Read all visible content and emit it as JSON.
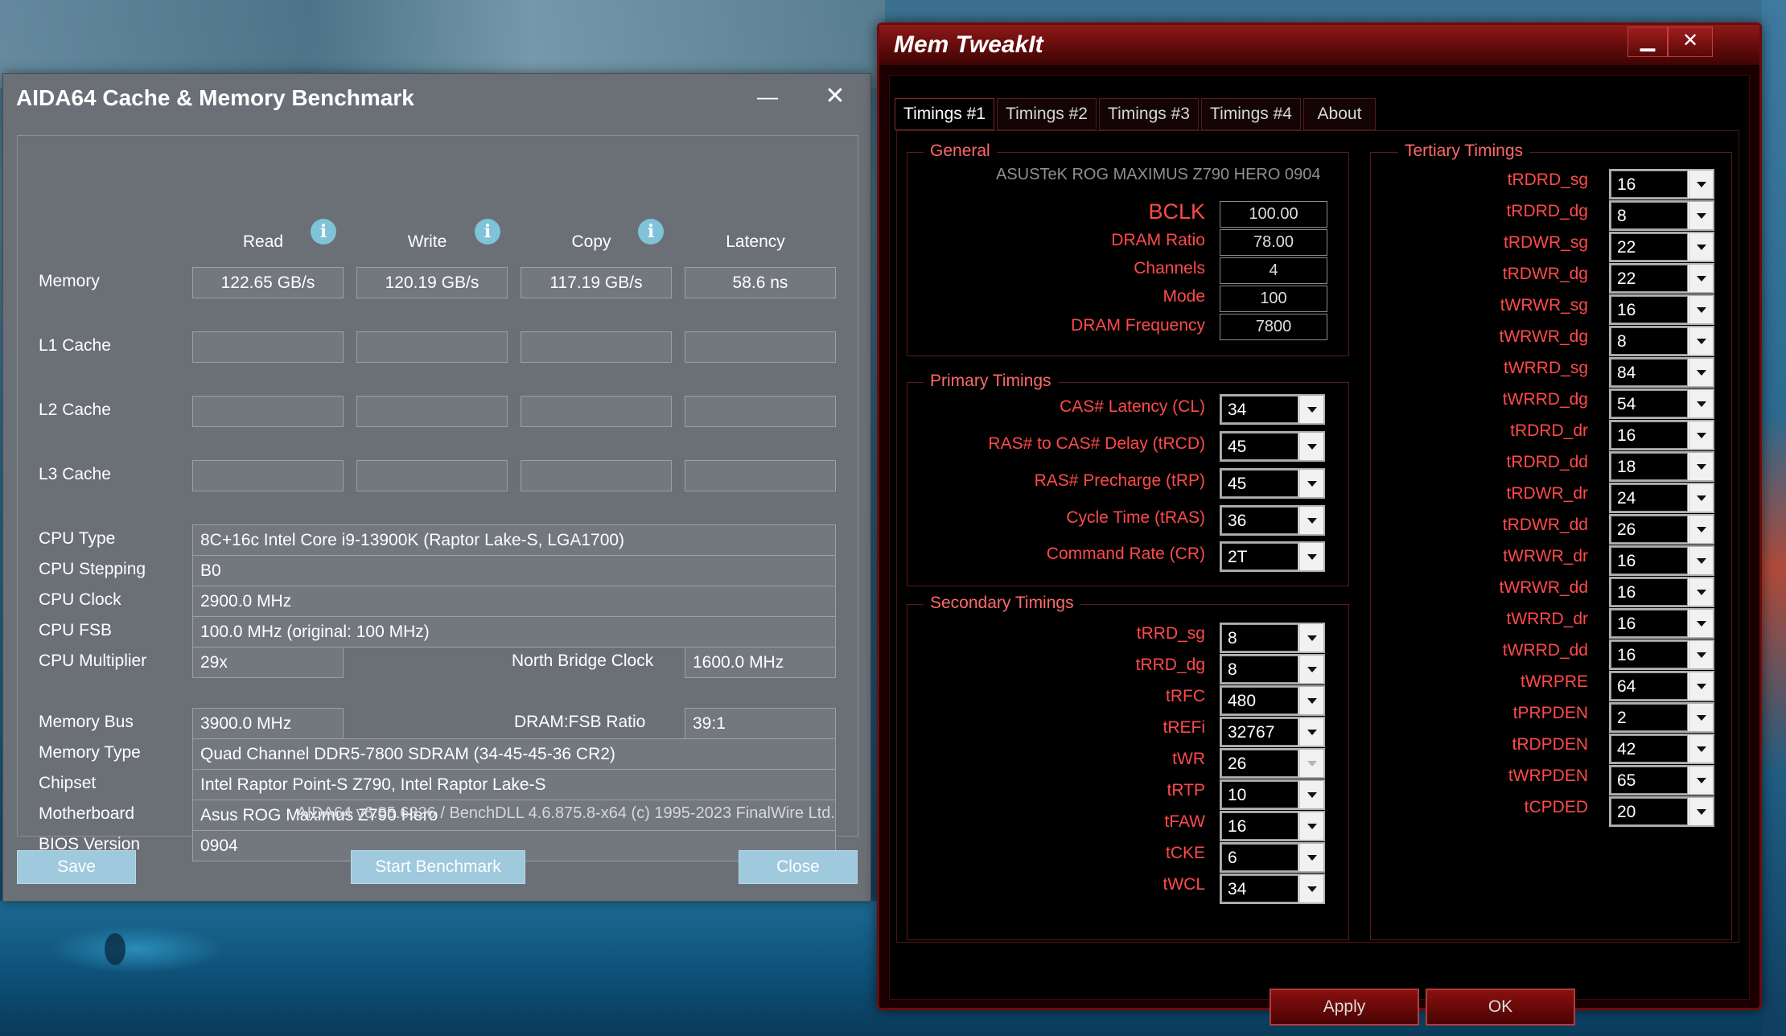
{
  "aida": {
    "title": "AIDA64 Cache & Memory Benchmark",
    "minimize": "—",
    "close_x": "✕",
    "headers": {
      "read": "Read",
      "write": "Write",
      "copy": "Copy",
      "latency": "Latency"
    },
    "info_glyph": "i",
    "rows": {
      "memory": {
        "label": "Memory",
        "read": "122.65 GB/s",
        "write": "120.19 GB/s",
        "copy": "117.19 GB/s",
        "latency": "58.6 ns"
      },
      "l1": {
        "label": "L1 Cache"
      },
      "l2": {
        "label": "L2 Cache"
      },
      "l3": {
        "label": "L3 Cache"
      }
    },
    "info": {
      "cpu_type": {
        "label": "CPU Type",
        "value": "8C+16c Intel Core i9-13900K  (Raptor Lake-S, LGA1700)"
      },
      "cpu_stepping": {
        "label": "CPU Stepping",
        "value": "B0"
      },
      "cpu_clock": {
        "label": "CPU Clock",
        "value": "2900.0 MHz"
      },
      "cpu_fsb": {
        "label": "CPU FSB",
        "value": "100.0 MHz  (original: 100 MHz)"
      },
      "cpu_multiplier": {
        "label": "CPU Multiplier",
        "value": "29x"
      },
      "nb_clock": {
        "label": "North Bridge Clock",
        "value": "1600.0 MHz"
      },
      "memory_bus": {
        "label": "Memory Bus",
        "value": "3900.0 MHz"
      },
      "dram_fsb": {
        "label": "DRAM:FSB Ratio",
        "value": "39:1"
      },
      "memory_type": {
        "label": "Memory Type",
        "value": "Quad Channel DDR5-7800 SDRAM  (34-45-45-36 CR2)"
      },
      "chipset": {
        "label": "Chipset",
        "value": "Intel Raptor Point-S Z790, Intel Raptor Lake-S"
      },
      "motherboard": {
        "label": "Motherboard",
        "value": "Asus ROG Maximus Z790 Hero"
      },
      "bios": {
        "label": "BIOS Version",
        "value": "0904"
      }
    },
    "footer": "AIDA64 v6.85.6326 / BenchDLL 4.6.875.8-x64  (c) 1995-2023 FinalWire Ltd.",
    "buttons": {
      "save": "Save",
      "start": "Start Benchmark",
      "close": "Close"
    }
  },
  "mti": {
    "title": "Mem TweakIt",
    "min_glyph": "▁",
    "close_glyph": "✕",
    "tabs": [
      "Timings #1",
      "Timings #2",
      "Timings #3",
      "Timings #4",
      "About"
    ],
    "general": {
      "title": "General",
      "model": "ASUSTeK ROG MAXIMUS Z790 HERO 0904",
      "fields": [
        {
          "label": "BCLK",
          "value": "100.00"
        },
        {
          "label": "DRAM Ratio",
          "value": "78.00"
        },
        {
          "label": "Channels",
          "value": "4"
        },
        {
          "label": "Mode",
          "value": "100"
        },
        {
          "label": "DRAM Frequency",
          "value": "7800"
        }
      ]
    },
    "primary": {
      "title": "Primary Timings",
      "fields": [
        {
          "label": "CAS# Latency (CL)",
          "value": "34"
        },
        {
          "label": "RAS# to CAS# Delay (tRCD)",
          "value": "45"
        },
        {
          "label": "RAS# Precharge (tRP)",
          "value": "45"
        },
        {
          "label": "Cycle Time (tRAS)",
          "value": "36"
        },
        {
          "label": "Command Rate (CR)",
          "value": "2T"
        }
      ]
    },
    "secondary": {
      "title": "Secondary Timings",
      "fields": [
        {
          "label": "tRRD_sg",
          "value": "8"
        },
        {
          "label": "tRRD_dg",
          "value": "8"
        },
        {
          "label": "tRFC",
          "value": "480"
        },
        {
          "label": "tREFi",
          "value": "32767"
        },
        {
          "label": "tWR",
          "value": "26"
        },
        {
          "label": "tRTP",
          "value": "10"
        },
        {
          "label": "tFAW",
          "value": "16"
        },
        {
          "label": "tCKE",
          "value": "6"
        },
        {
          "label": "tWCL",
          "value": "34"
        }
      ]
    },
    "tertiary": {
      "title": "Tertiary Timings",
      "fields": [
        {
          "label": "tRDRD_sg",
          "value": "16"
        },
        {
          "label": "tRDRD_dg",
          "value": "8"
        },
        {
          "label": "tRDWR_sg",
          "value": "22"
        },
        {
          "label": "tRDWR_dg",
          "value": "22"
        },
        {
          "label": "tWRWR_sg",
          "value": "16"
        },
        {
          "label": "tWRWR_dg",
          "value": "8"
        },
        {
          "label": "tWRRD_sg",
          "value": "84"
        },
        {
          "label": "tWRRD_dg",
          "value": "54"
        },
        {
          "label": "tRDRD_dr",
          "value": "16"
        },
        {
          "label": "tRDRD_dd",
          "value": "18"
        },
        {
          "label": "tRDWR_dr",
          "value": "24"
        },
        {
          "label": "tRDWR_dd",
          "value": "26"
        },
        {
          "label": "tWRWR_dr",
          "value": "16"
        },
        {
          "label": "tWRWR_dd",
          "value": "16"
        },
        {
          "label": "tWRRD_dr",
          "value": "16"
        },
        {
          "label": "tWRRD_dd",
          "value": "16"
        },
        {
          "label": "tWRPRE",
          "value": "64"
        },
        {
          "label": "tPRPDEN",
          "value": "2"
        },
        {
          "label": "tRDPDEN",
          "value": "42"
        },
        {
          "label": "tWRPDEN",
          "value": "65"
        },
        {
          "label": "tCPDED",
          "value": "20"
        }
      ]
    },
    "buttons": {
      "apply": "Apply",
      "ok": "OK"
    }
  }
}
